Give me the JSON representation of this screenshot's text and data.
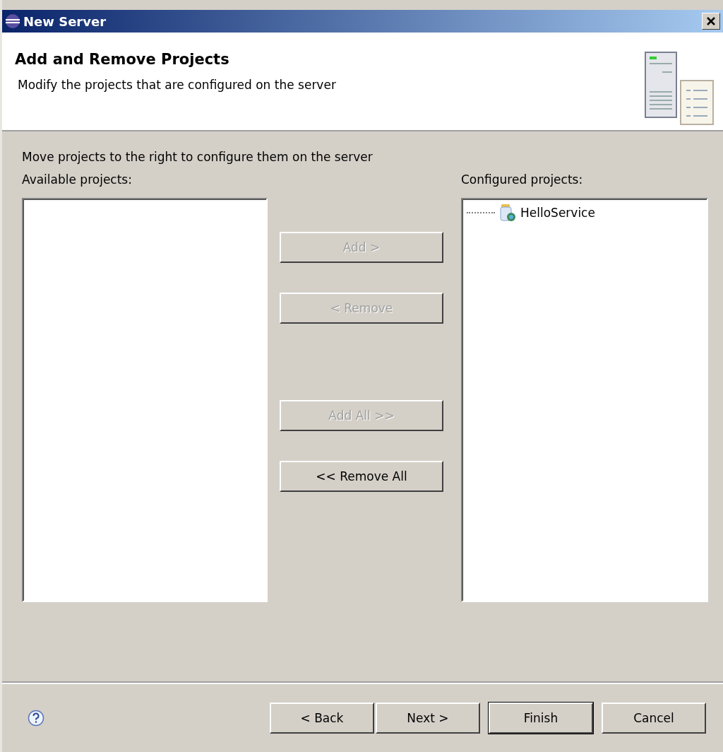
{
  "window": {
    "title": "New Server"
  },
  "header": {
    "title": "Add and Remove Projects",
    "description": "Modify the projects that are configured on the server"
  },
  "instruction": "Move projects to the right to configure them on the server",
  "available": {
    "label": "Available projects:"
  },
  "configured": {
    "label": "Configured projects:",
    "items": [
      {
        "label": "HelloService"
      }
    ]
  },
  "move_buttons": [
    {
      "label": "Add >",
      "disabled": true
    },
    {
      "label": "< Remove",
      "disabled": true
    },
    {
      "label": "Add All >>",
      "disabled": true
    },
    {
      "label": "<< Remove All",
      "disabled": false
    }
  ],
  "footer_buttons": [
    {
      "label": "< Back",
      "default": false
    },
    {
      "label": "Next >",
      "default": false
    },
    {
      "label": "Finish",
      "default": true
    },
    {
      "label": "Cancel",
      "default": false
    }
  ]
}
